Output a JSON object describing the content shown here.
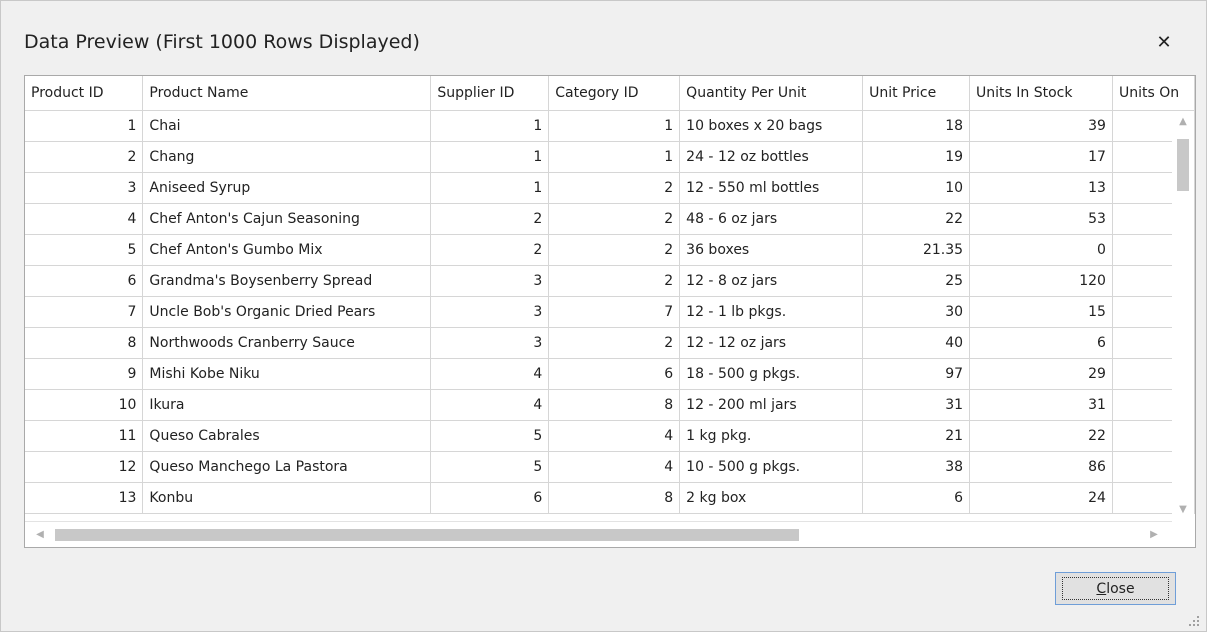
{
  "window": {
    "title": "Data Preview (First 1000 Rows Displayed)",
    "close_glyph": "✕"
  },
  "grid": {
    "columns": [
      "Product ID",
      "Product Name",
      "Supplier ID",
      "Category ID",
      "Quantity Per Unit",
      "Unit Price",
      "Units In Stock",
      "Units On"
    ],
    "rows": [
      [
        "1",
        "Chai",
        "1",
        "1",
        "10 boxes x 20 bags",
        "18",
        "39"
      ],
      [
        "2",
        "Chang",
        "1",
        "1",
        "24 - 12 oz bottles",
        "19",
        "17"
      ],
      [
        "3",
        "Aniseed Syrup",
        "1",
        "2",
        "12 - 550 ml bottles",
        "10",
        "13"
      ],
      [
        "4",
        "Chef Anton's Cajun Seasoning",
        "2",
        "2",
        "48 - 6 oz jars",
        "22",
        "53"
      ],
      [
        "5",
        "Chef Anton's Gumbo Mix",
        "2",
        "2",
        "36 boxes",
        "21.35",
        "0"
      ],
      [
        "6",
        "Grandma's Boysenberry Spread",
        "3",
        "2",
        "12 - 8 oz jars",
        "25",
        "120"
      ],
      [
        "7",
        "Uncle Bob's Organic Dried Pears",
        "3",
        "7",
        "12 - 1 lb pkgs.",
        "30",
        "15"
      ],
      [
        "8",
        "Northwoods Cranberry Sauce",
        "3",
        "2",
        "12 - 12 oz jars",
        "40",
        "6"
      ],
      [
        "9",
        "Mishi Kobe Niku",
        "4",
        "6",
        "18 - 500 g pkgs.",
        "97",
        "29"
      ],
      [
        "10",
        "Ikura",
        "4",
        "8",
        "12 - 200 ml jars",
        "31",
        "31"
      ],
      [
        "11",
        "Queso Cabrales",
        "5",
        "4",
        "1 kg pkg.",
        "21",
        "22"
      ],
      [
        "12",
        "Queso Manchego La Pastora",
        "5",
        "4",
        "10 - 500 g pkgs.",
        "38",
        "86"
      ],
      [
        "13",
        "Konbu",
        "6",
        "8",
        "2 kg box",
        "6",
        "24"
      ]
    ]
  },
  "footer": {
    "close_button": {
      "mnemonic": "C",
      "rest": "lose"
    }
  },
  "icons": {
    "close": "close-icon",
    "scroll_up": "chevron-up-icon",
    "scroll_down": "chevron-down-icon",
    "scroll_left": "chevron-left-icon",
    "scroll_right": "chevron-right-icon",
    "resize_grip": "resize-grip-icon"
  },
  "colors": {
    "dialog_background": "#f0f0f0",
    "grid_background": "#ffffff",
    "grid_lines": "#d6d6d6",
    "button_border": "#6f9ed8",
    "scroll_thumb": "#c8c8c8"
  }
}
